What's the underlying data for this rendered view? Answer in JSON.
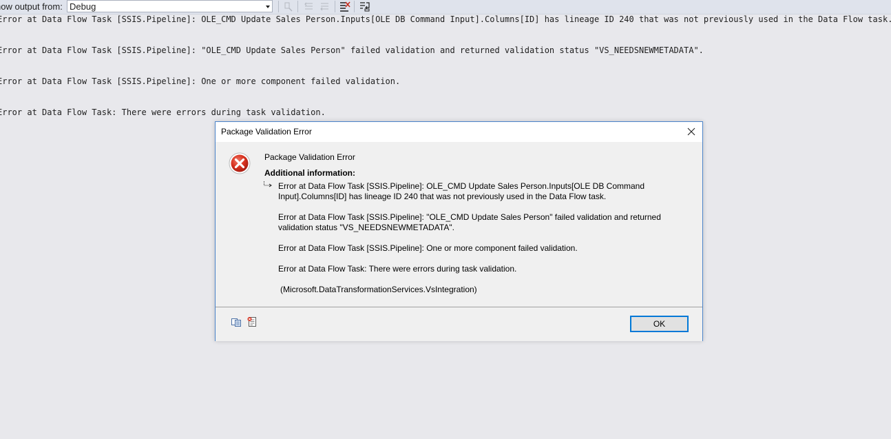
{
  "toolbar": {
    "label": "how output from:",
    "source_value": "Debug"
  },
  "output": {
    "lines": [
      "Error at Data Flow Task [SSIS.Pipeline]: OLE_CMD Update Sales Person.Inputs[OLE DB Command Input].Columns[ID] has lineage ID 240 that was not previously used in the Data Flow task.",
      "Error at Data Flow Task [SSIS.Pipeline]: \"OLE_CMD Update Sales Person\" failed validation and returned validation status \"VS_NEEDSNEWMETADATA\".",
      "Error at Data Flow Task [SSIS.Pipeline]: One or more component failed validation.",
      "Error at Data Flow Task: There were errors during task validation."
    ]
  },
  "dialog": {
    "title": "Package Validation Error",
    "heading": "Package Validation Error",
    "additional_label": "Additional information:",
    "details": [
      "Error at Data Flow Task [SSIS.Pipeline]: OLE_CMD Update Sales Person.Inputs[OLE DB Command Input].Columns[ID] has lineage ID 240 that was not previously used in the Data Flow task.",
      "Error at Data Flow Task [SSIS.Pipeline]: \"OLE_CMD Update Sales Person\" failed validation and returned validation status \"VS_NEEDSNEWMETADATA\".",
      "Error at Data Flow Task [SSIS.Pipeline]: One or more component failed validation.",
      "Error at Data Flow Task: There were errors during task validation."
    ],
    "source": "(Microsoft.DataTransformationServices.VsIntegration)",
    "ok_label": "OK"
  },
  "colors": {
    "output_background": "#e8e8ec",
    "dialog_border": "#4a83c9",
    "error_red": "#c42b1c",
    "ok_focus": "#0078d7"
  },
  "icons": {
    "dialog_icon": "error-icon",
    "close": "close-icon",
    "footer": [
      "copy-icon",
      "technical-details-icon"
    ],
    "toolbar": [
      "find-message-icon",
      "previous-message-icon",
      "next-message-icon",
      "clear-all-icon",
      "word-wrap-icon"
    ]
  }
}
